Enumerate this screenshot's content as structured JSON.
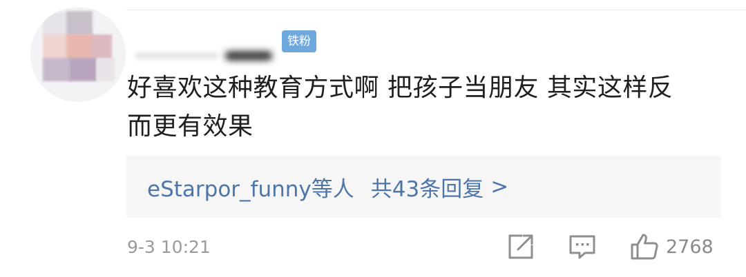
{
  "comment": {
    "badge": "铁粉",
    "text_line1": "好喜欢这种教育方式啊 把孩子当朋友 其实这样反",
    "text_line2": "而更有效果",
    "replies": {
      "users": "eStarpor_funny等人",
      "count": "共43条回复",
      "chevron": ">"
    },
    "timestamp": "9-3 10:21",
    "actions": {
      "share_icon": "share-icon",
      "comment_icon": "comment-icon",
      "like_icon": "like-icon",
      "like_count": "2768"
    }
  },
  "colors": {
    "badge_bg": "#6ea8dd",
    "link": "#4e75a8",
    "text": "#1f1f1f",
    "muted": "#9a9a9a",
    "reply_bg": "#f6f6f6"
  }
}
